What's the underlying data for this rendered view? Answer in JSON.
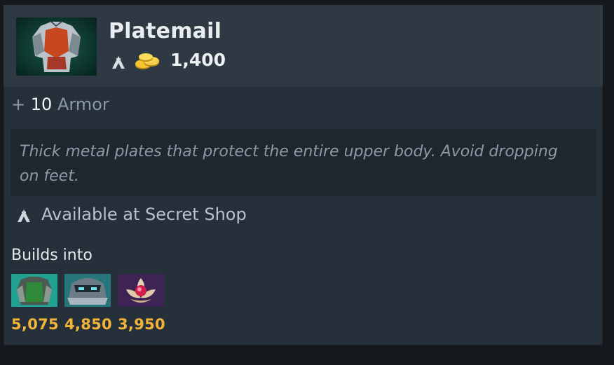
{
  "item": {
    "name": "Platemail",
    "icon": "chest-armor-icon",
    "cost": "1,400",
    "cost_icon": "gold-coins-icon",
    "shop_marker_icon": "secret-shop-icon"
  },
  "stats": [
    {
      "prefix": "+",
      "value": "10",
      "label": "Armor"
    }
  ],
  "lore": "Thick metal plates that protect the entire upper body. Avoid dropping on feet.",
  "availability": {
    "icon": "secret-shop-icon",
    "text": "Available at Secret Shop"
  },
  "builds_into": {
    "title": "Builds into",
    "items": [
      {
        "icon": "green-armor-icon",
        "cost": "5,075"
      },
      {
        "icon": "steel-helm-armor-icon",
        "cost": "4,850"
      },
      {
        "icon": "lotus-orb-icon",
        "cost": "3,950"
      }
    ]
  },
  "colors": {
    "background": "#26303b",
    "header": "#2f3943",
    "lore_box": "#1f262e",
    "cost_gold": "#f2b53a"
  }
}
